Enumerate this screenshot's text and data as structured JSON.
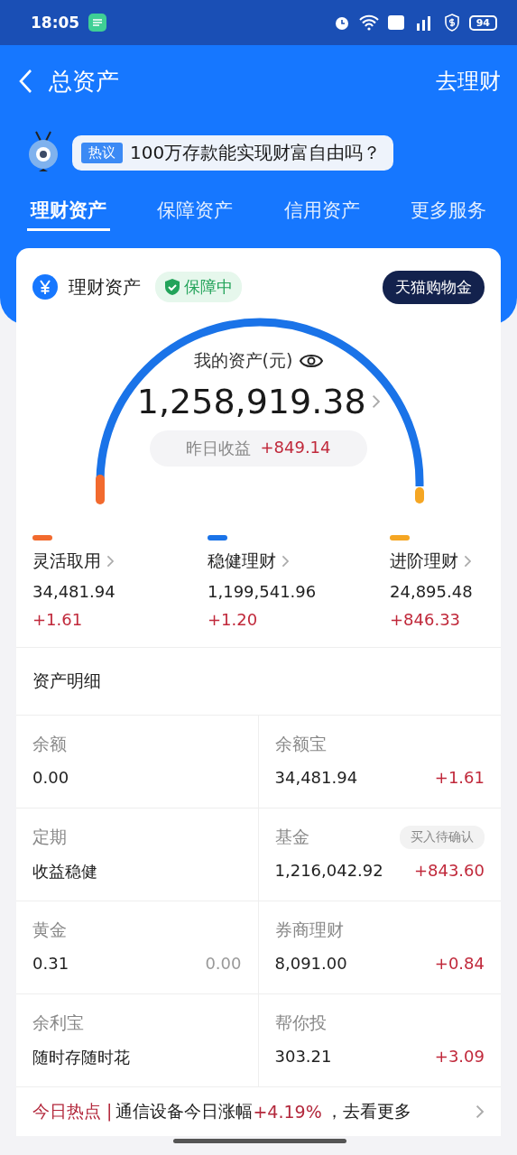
{
  "status_bar": {
    "time": "18:05",
    "battery": "94"
  },
  "nav": {
    "title": "总资产",
    "action": "去理财"
  },
  "hot_topic": {
    "tag": "热议",
    "text": "100万存款能实现财富自由吗？"
  },
  "tabs": [
    {
      "label": "理财资产",
      "selected": true
    },
    {
      "label": "保障资产",
      "selected": false
    },
    {
      "label": "信用资产",
      "selected": false
    },
    {
      "label": "更多服务",
      "selected": false
    }
  ],
  "card": {
    "title": "理财资产",
    "badge": "保障中",
    "promo": "天猫购物金",
    "asset_label": "我的资产(元)",
    "total": "1,258,919.38",
    "yesterday_label": "昨日收益",
    "yesterday_value": "+849.14"
  },
  "categories": [
    {
      "label": "灵活取用",
      "color": "#f26a2e",
      "value": "34,481.94",
      "change": "+1.61"
    },
    {
      "label": "稳健理财",
      "color": "#1a73e8",
      "value": "1,199,541.96",
      "change": "+1.20"
    },
    {
      "label": "进阶理财",
      "color": "#f5a623",
      "value": "24,895.48",
      "change": "+846.33"
    }
  ],
  "details": {
    "title": "资产明细",
    "items": [
      {
        "label": "余额",
        "value": "0.00"
      },
      {
        "label": "余额宝",
        "value": "34,481.94",
        "change": "+1.61",
        "color": "#c0283a"
      },
      {
        "label": "定期",
        "value": "收益稳健"
      },
      {
        "label": "基金",
        "badge": "买入待确认",
        "value": "1,216,042.92",
        "change": "+843.60",
        "color": "#c0283a"
      },
      {
        "label": "黄金",
        "value": "0.31",
        "change": "0.00",
        "color": "#999999"
      },
      {
        "label": "券商理财",
        "value": "8,091.00",
        "change": "+0.84",
        "color": "#c0283a"
      },
      {
        "label": "余利宝",
        "value": "随时存随时花"
      },
      {
        "label": "帮你投",
        "value": "303.21",
        "change": "+3.09",
        "color": "#c0283a"
      }
    ]
  },
  "news": {
    "label": "今日热点 |",
    "text": "通信设备今日涨幅",
    "change": "+4.19%",
    "tail": "，去看更多"
  }
}
